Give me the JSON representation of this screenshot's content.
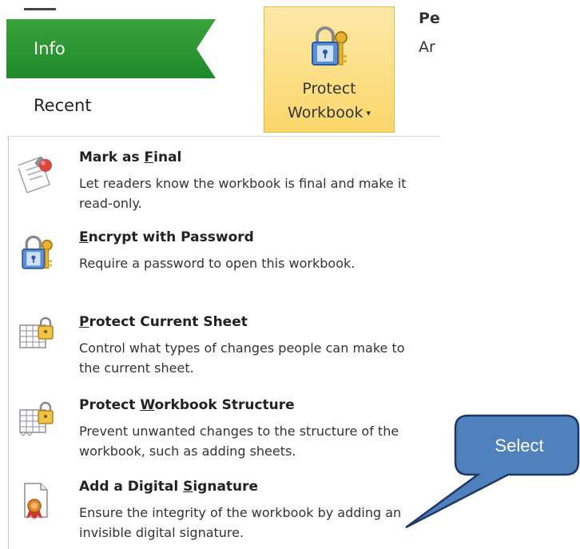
{
  "nav": {
    "info": "Info",
    "recent": "Recent"
  },
  "protect_button": {
    "line1": "Protect",
    "line2": "Workbook",
    "caret": "▾",
    "icon": "lock-key-icon"
  },
  "info_side": {
    "title_fragment": "Pe",
    "subtitle_fragment": "Ar"
  },
  "menu": {
    "items": [
      {
        "title_prefix": "Mark as ",
        "title_access": "F",
        "title_suffix": "inal",
        "description": "Let readers know the workbook is final and make it read-only.",
        "icon": "mark-final-icon"
      },
      {
        "title_prefix": "",
        "title_access": "E",
        "title_suffix": "ncrypt with Password",
        "description": "Require a password to open this workbook.",
        "icon": "lock-key-icon"
      },
      {
        "title_prefix": "",
        "title_access": "P",
        "title_suffix": "rotect Current Sheet",
        "description": "Control what types of changes people can make to the current sheet.",
        "icon": "sheet-lock-icon"
      },
      {
        "title_prefix": "Protect ",
        "title_access": "W",
        "title_suffix": "orkbook Structure",
        "description": "Prevent unwanted changes to the structure of the workbook, such as adding sheets.",
        "icon": "workbook-lock-icon"
      },
      {
        "title_prefix": "Add a Digital ",
        "title_access": "S",
        "title_suffix": "ignature",
        "description": "Ensure the integrity of the workbook by adding an invisible digital signature.",
        "icon": "digital-signature-icon"
      }
    ]
  },
  "callout": {
    "label": "Select",
    "fill": "#4f81bd",
    "stroke": "#1f3864"
  },
  "colors": {
    "nav_active": "#2a962e",
    "button_highlight": "#fbd66a"
  }
}
